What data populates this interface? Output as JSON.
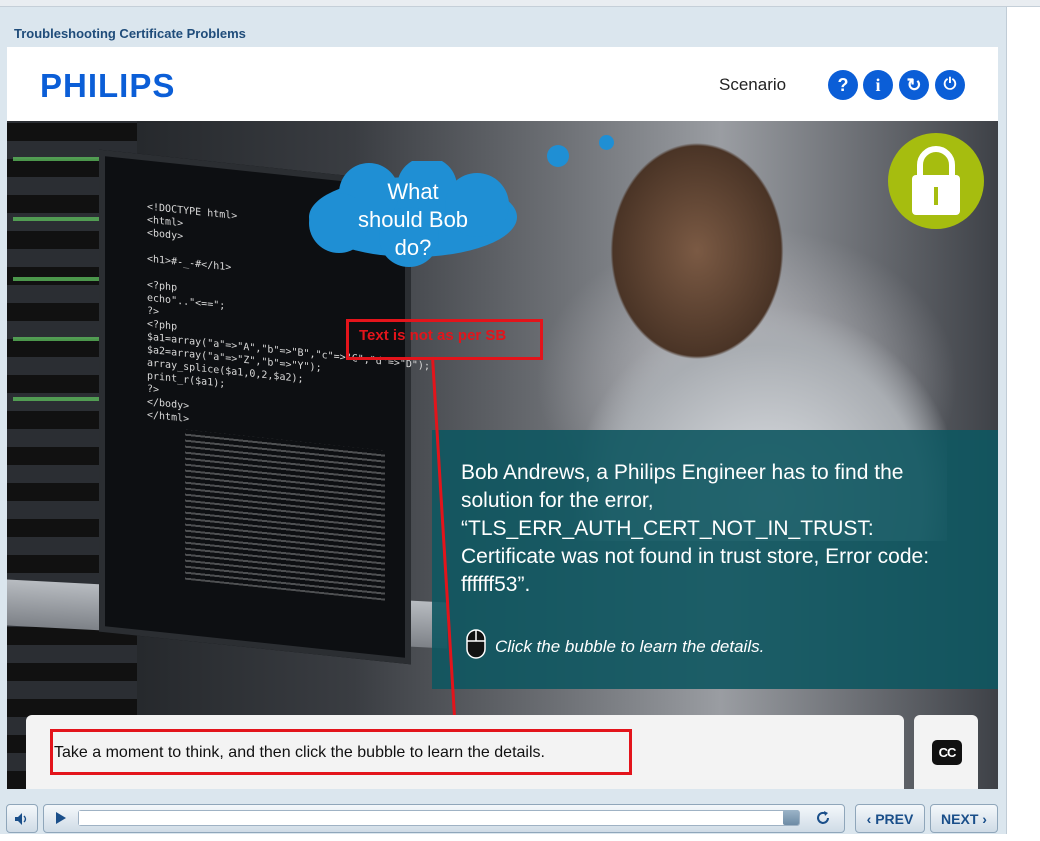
{
  "course": {
    "title": "Troubleshooting Certificate Problems"
  },
  "header": {
    "logo": "PHILIPS",
    "section": "Scenario",
    "buttons": {
      "help": "?",
      "info": "i",
      "replay": "↻",
      "exit": "⏻"
    }
  },
  "slide": {
    "bubble": "What should Bob do?",
    "info_text": "Bob Andrews, a Philips Engineer has to find the solution for the error, “TLS_ERR_AUTH_CERT_NOT_IN_TRUST: Certificate was not found in trust store, Error code: ffffff53”.",
    "hint": "Click the bubble to learn the details.",
    "annotation": "Text is not as per SB",
    "screen_code": "<!DOCTYPE html>\n<html>\n<body>\n\n<h1>#-_-#</h1>\n\n<?php\necho\"..\"<==\";\n?>\n<?php\n$a1=array(\"a\"=>\"A\",\"b\"=>\"B\",\"c\"=>\"C\",\"d\"=>\"D\");\n$a2=array(\"a\"=>\"Z\",\"b\"=>\"Y\");\narray_splice($a1,0,2,$a2);\nprint_r($a1);\n?>\n</body>\n</html>",
    "icons": {
      "lock": "lock-icon",
      "mouse": "mouse-icon"
    },
    "colors": {
      "accent": "#0b5ed7",
      "info_bg": "#0e5660",
      "lock": "#a6bd0f",
      "annotation": "#e3141b"
    }
  },
  "caption": {
    "text": "Take a moment to think, and then click the bubble to learn the details.",
    "cc_label": "CC"
  },
  "controls": {
    "prev": "‹ PREV",
    "next": "NEXT ›",
    "progress": 0.98
  }
}
